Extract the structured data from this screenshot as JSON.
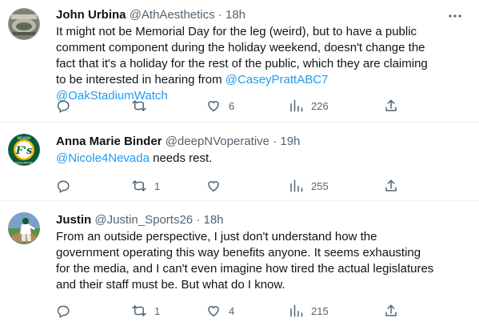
{
  "tweets": [
    {
      "name": "John Urbina",
      "handle": "@AthAesthetics",
      "sep": "·",
      "time": "18h",
      "text_parts": [
        "It might not be Memorial Day for the leg (weird), but to have a public comment component during the holiday weekend, doesn't change the fact that it's a holiday for the rest of the public, which they are claiming to be interested in hearing from "
      ],
      "mentions": [
        "@CaseyPrattABC7",
        "@OakStadiumWatch"
      ],
      "replies": "",
      "retweets": "",
      "likes": "6",
      "views": "226"
    },
    {
      "name": "Anna Marie Binder",
      "handle": "@deepNVoperative",
      "sep": "·",
      "time": "19h",
      "mention": "@Nicole4Nevada",
      "text_after": " needs rest.",
      "avatar_text_top": "NEVADA",
      "avatar_text_bottom": "EDUCATION",
      "replies": "",
      "retweets": "1",
      "likes": "",
      "views": "255"
    },
    {
      "name": "Justin",
      "handle": "@Justin_Sports26",
      "sep": "·",
      "time": "18h",
      "text": "From an outside perspective, I just don't understand how the government operating this way benefits anyone. It seems exhausting for the media, and I can't even imagine how tired the actual legislatures and their staff must be. But what do I know.",
      "replies": "",
      "retweets": "1",
      "likes": "4",
      "views": "215"
    }
  ],
  "icons": {
    "reply": "reply-icon",
    "retweet": "retweet-icon",
    "like": "heart-icon",
    "views": "views-icon",
    "share": "share-icon",
    "more": "more-icon"
  },
  "colors": {
    "mention": "#1d9bf0",
    "secondary_text": "#536471",
    "divider": "#eff3f4",
    "a_logo_green": "#0a5c36",
    "a_logo_gold": "#f2b90f"
  }
}
